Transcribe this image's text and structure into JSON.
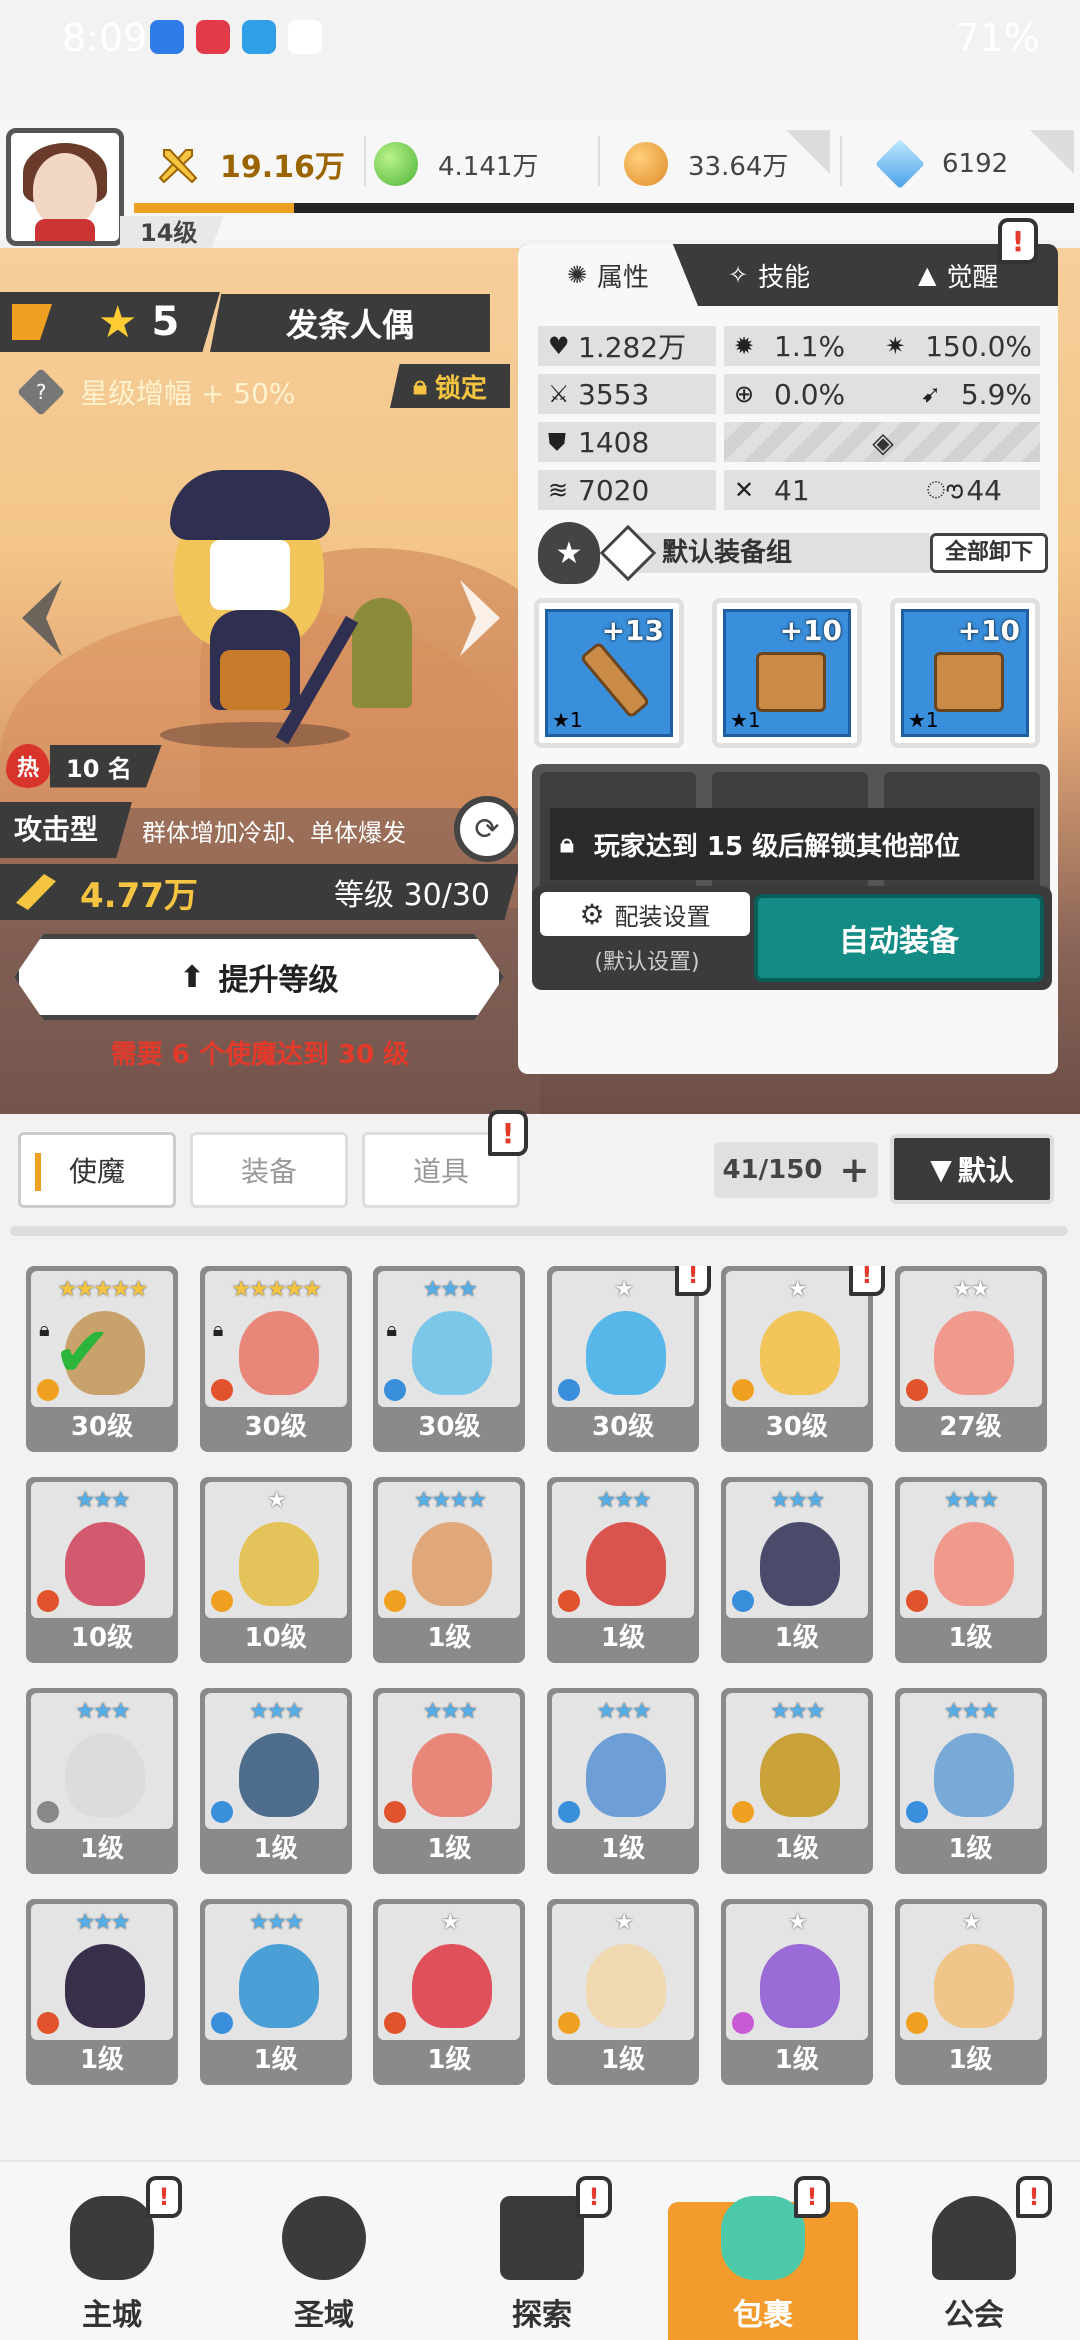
{
  "status_bar": {
    "time": "8:09",
    "battery": "71%"
  },
  "player": {
    "level": "14级",
    "exp_progress": 0.17
  },
  "resources": {
    "power": "19.16万",
    "green": "4.141万",
    "gold": "33.64万",
    "gem": "6192"
  },
  "hero": {
    "stars": "5",
    "name": "发条人偶",
    "star_bonus": "星级增幅 + 50%",
    "lock_label": "锁定",
    "hot_rank_icon": "热",
    "hot_rank": "10 名",
    "type": "攻击型",
    "description": "群体增加冷却、单体爆发",
    "power": "4.77万",
    "level": "等级 30/30",
    "upgrade_label": "提升等级",
    "requirement": "需要 6 个使魔达到 30 级"
  },
  "panel": {
    "tabs": [
      {
        "label": "属性"
      },
      {
        "label": "技能"
      },
      {
        "label": "觉醒"
      }
    ],
    "stats": {
      "hp": "1.282万",
      "crit": "1.1%",
      "crit_dmg": "150.0%",
      "atk": "3553",
      "accuracy": "0.0%",
      "dodge": "5.9%",
      "def": "1408",
      "speed": "7020",
      "stat_a": "41",
      "stat_b": "44"
    },
    "equip_set_name": "默认装备组",
    "unequip_all": "全部卸下",
    "equipment": [
      {
        "name": "sword",
        "plus": "+13",
        "star": "★1"
      },
      {
        "name": "helmet",
        "plus": "+10",
        "star": "★1"
      },
      {
        "name": "armor",
        "plus": "+10",
        "star": "★1"
      }
    ],
    "locked_message": "玩家达到 15 级后解锁其他部位",
    "config_label": "配装设置",
    "config_sub": "(默认设置)",
    "auto_equip": "自动装备"
  },
  "list": {
    "categories": [
      "使魔",
      "装备",
      "道具"
    ],
    "count": "41/150",
    "sort_label": "默认",
    "cards": [
      {
        "level": "30级",
        "stars": "★★★★★",
        "star_color": "#f5c542",
        "color": "#c9a16b",
        "elem": "#f0a020",
        "locked": true,
        "checked": true,
        "badge": false
      },
      {
        "level": "30级",
        "stars": "★★★★★",
        "star_color": "#f5c542",
        "color": "#e9867a",
        "elem": "#e0532c",
        "locked": true,
        "checked": false,
        "badge": false
      },
      {
        "level": "30级",
        "stars": "★★★",
        "star_color": "#56aee8",
        "color": "#7cc6e8",
        "elem": "#3a8fdc",
        "locked": true,
        "checked": false,
        "badge": false
      },
      {
        "level": "30级",
        "stars": "★",
        "star_color": "#ffffff",
        "color": "#56b7e8",
        "elem": "#3a8fdc",
        "locked": false,
        "checked": false,
        "badge": true
      },
      {
        "level": "30级",
        "stars": "★",
        "star_color": "#ffffff",
        "color": "#f1c55a",
        "elem": "#f0a020",
        "locked": false,
        "checked": false,
        "badge": true
      },
      {
        "level": "27级",
        "stars": "★★",
        "star_color": "#ffffff",
        "color": "#f09a8e",
        "elem": "#e0532c",
        "locked": false,
        "checked": false,
        "badge": false
      },
      {
        "level": "10级",
        "stars": "★★★",
        "star_color": "#56aee8",
        "color": "#d35a6e",
        "elem": "#e0532c",
        "locked": false,
        "checked": false,
        "badge": false
      },
      {
        "level": "10级",
        "stars": "★",
        "star_color": "#ffffff",
        "color": "#e3c35a",
        "elem": "#f0a020",
        "locked": false,
        "checked": false,
        "badge": false
      },
      {
        "level": "1级",
        "stars": "★★★★",
        "star_color": "#56aee8",
        "color": "#e0a87a",
        "elem": "#f0a020",
        "locked": false,
        "checked": false,
        "badge": false
      },
      {
        "level": "1级",
        "stars": "★★★",
        "star_color": "#56aee8",
        "color": "#d9534f",
        "elem": "#e0532c",
        "locked": false,
        "checked": false,
        "badge": false
      },
      {
        "level": "1级",
        "stars": "★★★",
        "star_color": "#56aee8",
        "color": "#4a4a6a",
        "elem": "#3a8fdc",
        "locked": false,
        "checked": false,
        "badge": false
      },
      {
        "level": "1级",
        "stars": "★★★",
        "star_color": "#56aee8",
        "color": "#f09a8e",
        "elem": "#e0532c",
        "locked": false,
        "checked": false,
        "badge": false
      },
      {
        "level": "1级",
        "stars": "★★★",
        "star_color": "#56aee8",
        "color": "#dcdcdc",
        "elem": "#888888",
        "locked": false,
        "checked": false,
        "badge": false
      },
      {
        "level": "1级",
        "stars": "★★★",
        "star_color": "#56aee8",
        "color": "#4e6c8c",
        "elem": "#3a8fdc",
        "locked": false,
        "checked": false,
        "badge": false
      },
      {
        "level": "1级",
        "stars": "★★★",
        "star_color": "#56aee8",
        "color": "#e9867a",
        "elem": "#e0532c",
        "locked": false,
        "checked": false,
        "badge": false
      },
      {
        "level": "1级",
        "stars": "★★★",
        "star_color": "#56aee8",
        "color": "#6d9fd6",
        "elem": "#3a8fdc",
        "locked": false,
        "checked": false,
        "badge": false
      },
      {
        "level": "1级",
        "stars": "★★★",
        "star_color": "#56aee8",
        "color": "#c9a23a",
        "elem": "#f0a020",
        "locked": false,
        "checked": false,
        "badge": false
      },
      {
        "level": "1级",
        "stars": "★★★",
        "star_color": "#56aee8",
        "color": "#79a9d6",
        "elem": "#3a8fdc",
        "locked": false,
        "checked": false,
        "badge": false
      },
      {
        "level": "1级",
        "stars": "★★★",
        "star_color": "#56aee8",
        "color": "#3a2f4a",
        "elem": "#e0532c",
        "locked": false,
        "checked": false,
        "badge": false
      },
      {
        "level": "1级",
        "stars": "★★★",
        "star_color": "#56aee8",
        "color": "#4aa0d6",
        "elem": "#3a8fdc",
        "locked": false,
        "checked": false,
        "badge": false
      },
      {
        "level": "1级",
        "stars": "★",
        "star_color": "#ffffff",
        "color": "#e0505a",
        "elem": "#e0532c",
        "locked": false,
        "checked": false,
        "badge": false
      },
      {
        "level": "1级",
        "stars": "★",
        "star_color": "#ffffff",
        "color": "#f0d8b0",
        "elem": "#f0a020",
        "locked": false,
        "checked": false,
        "badge": false
      },
      {
        "level": "1级",
        "stars": "★",
        "star_color": "#ffffff",
        "color": "#9a6ad6",
        "elem": "#c95ad6",
        "locked": false,
        "checked": false,
        "badge": false
      },
      {
        "level": "1级",
        "stars": "★",
        "star_color": "#ffffff",
        "color": "#f0c58a",
        "elem": "#f0a020",
        "locked": false,
        "checked": false,
        "badge": false
      }
    ]
  },
  "nav": [
    {
      "label": "主城"
    },
    {
      "label": "圣域"
    },
    {
      "label": "探索"
    },
    {
      "label": "包裹"
    },
    {
      "label": "公会"
    }
  ],
  "colors": {
    "accent": "#f39b2c",
    "primary_button": "#138c85",
    "warning": "#e33a2c",
    "dark": "#3b3b3b"
  }
}
